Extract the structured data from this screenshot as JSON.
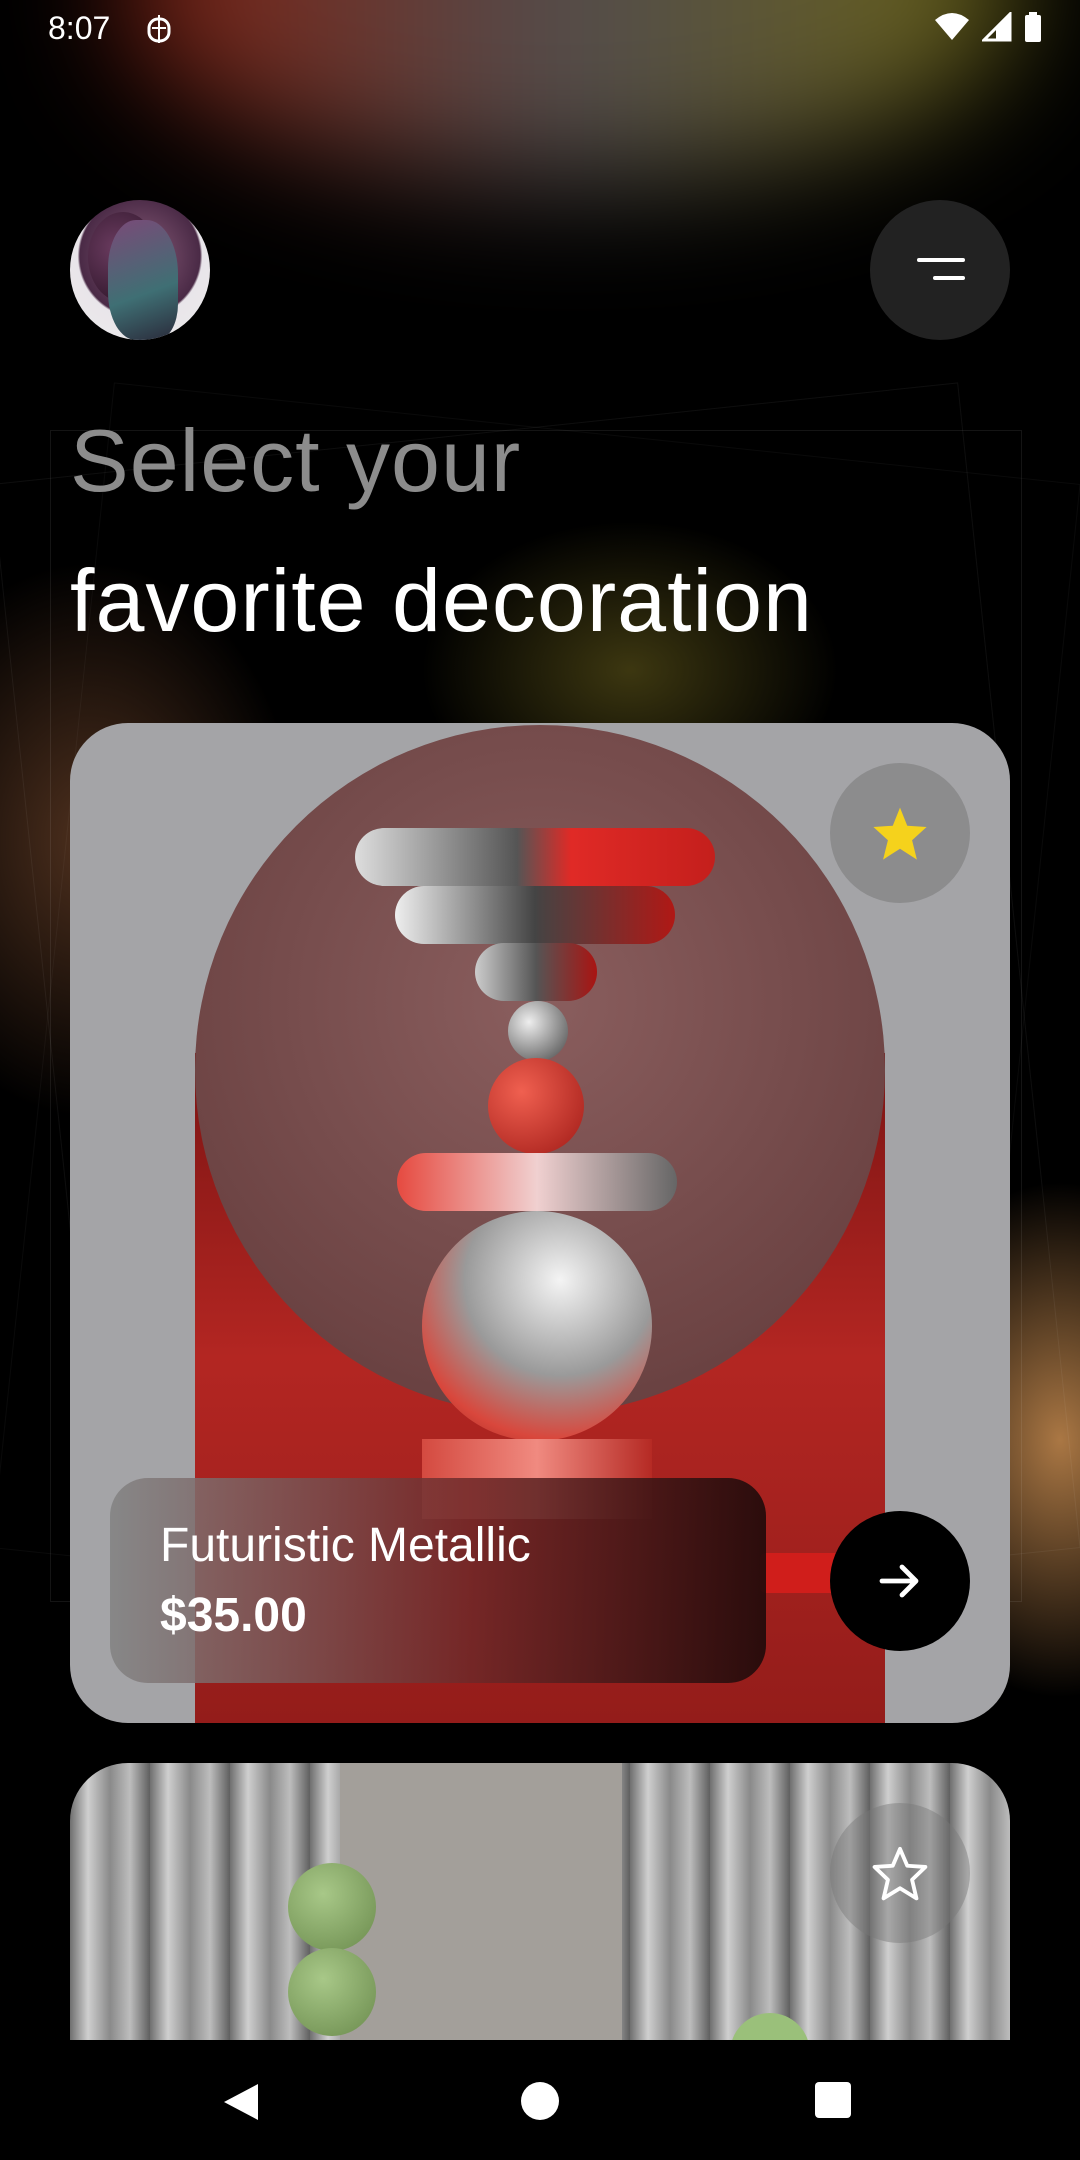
{
  "status_bar": {
    "time": "8:07"
  },
  "header": {
    "title_line1": "Select your",
    "title_line2": "favorite decoration"
  },
  "products": [
    {
      "name": "Futuristic Metallic",
      "price": "$35.00",
      "favorite": true
    },
    {
      "favorite": false
    }
  ],
  "colors": {
    "background": "#000000",
    "favorite_star": "#f5d21c",
    "card_background": "#a4a4a7"
  }
}
